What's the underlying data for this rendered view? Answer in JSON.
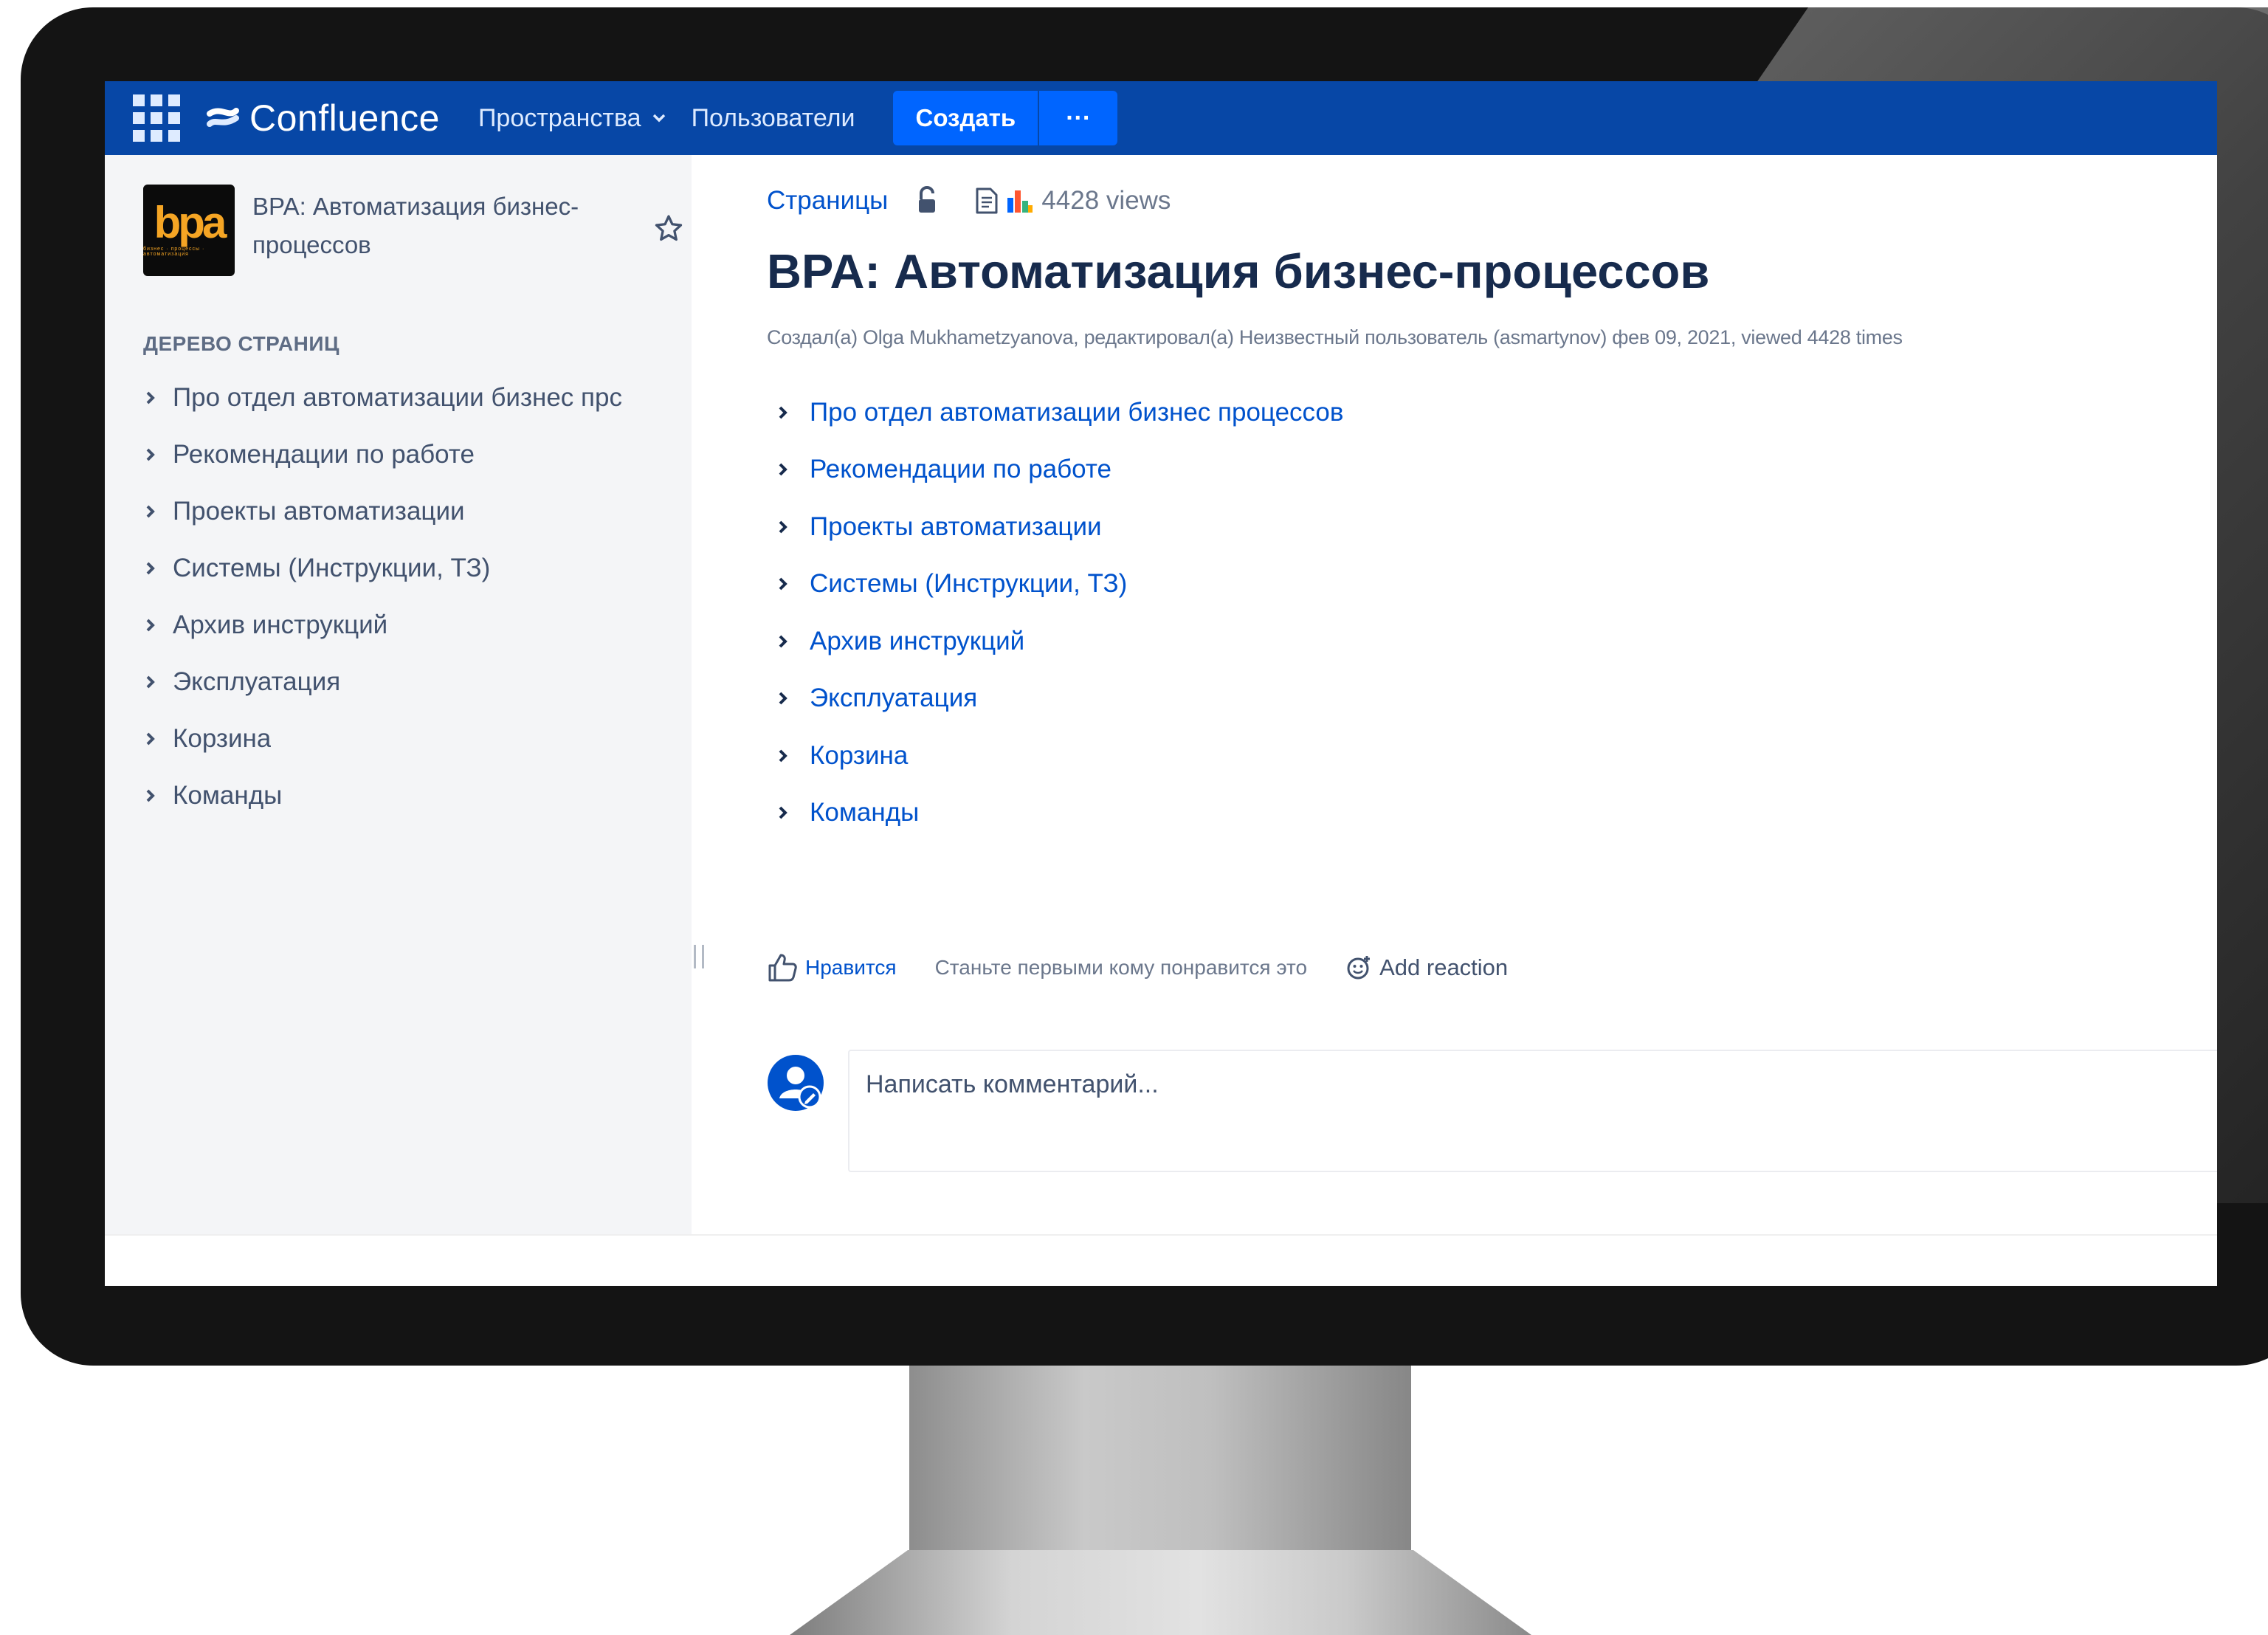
{
  "nav": {
    "logo_text": "Confluence",
    "spaces_label": "Пространства",
    "users_label": "Пользователи",
    "create_label": "Создать",
    "more_label": "···"
  },
  "sidebar": {
    "space_name": "BPA: Автоматизация бизнес-процессов",
    "logo_text": "bpa",
    "logo_subtext": "бизнес · процессы · автоматизация",
    "tree_heading": "ДЕРЕВО СТРАНИЦ",
    "tree_items": [
      {
        "label": "Про отдел автоматизации бизнес прс"
      },
      {
        "label": "Рекомендации по работе"
      },
      {
        "label": "Проекты автоматизации"
      },
      {
        "label": "Системы (Инструкции, ТЗ)"
      },
      {
        "label": "Архив инструкций"
      },
      {
        "label": "Эксплуатация"
      },
      {
        "label": "Корзина"
      },
      {
        "label": "Команды"
      }
    ]
  },
  "page": {
    "breadcrumb": "Страницы",
    "views": "4428 views",
    "title": "BPA: Автоматизация бизнес-процессов",
    "meta": "Создал(а) Olga Mukhametzyanova, редактировал(а) Неизвестный пользователь (asmartynov) фев 09, 2021, viewed 4428 times",
    "children": [
      {
        "label": "Про отдел автоматизации бизнес процессов"
      },
      {
        "label": "Рекомендации по работе"
      },
      {
        "label": "Проекты автоматизации"
      },
      {
        "label": "Системы (Инструкции, ТЗ)"
      },
      {
        "label": "Архив инструкций"
      },
      {
        "label": "Эксплуатация"
      },
      {
        "label": "Корзина"
      },
      {
        "label": "Команды"
      }
    ]
  },
  "reactions": {
    "like_label": "Нравится",
    "like_hint": "Станьте первыми кому понравится это",
    "add_reaction": "Add reaction"
  },
  "comment": {
    "placeholder": "Написать комментарий..."
  },
  "colors": {
    "nav_bg": "#0747a6",
    "create_button": "#0065ff",
    "link": "#0052cc",
    "sidebar_bg": "#f4f5f7",
    "logo_accent": "#f5a524"
  }
}
